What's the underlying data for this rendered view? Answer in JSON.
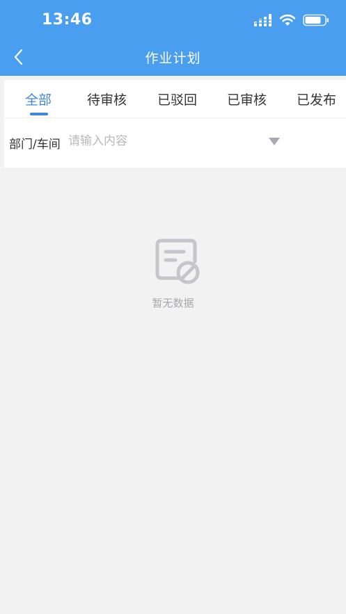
{
  "status_bar": {
    "time": "13:46"
  },
  "nav": {
    "title": "作业计划",
    "back_icon": "chevron-left-icon"
  },
  "tabs": [
    {
      "label": "全部",
      "active": true
    },
    {
      "label": "待审核",
      "active": false
    },
    {
      "label": "已驳回",
      "active": false
    },
    {
      "label": "已审核",
      "active": false
    },
    {
      "label": "已发布",
      "active": false
    }
  ],
  "filter": {
    "label": "部门/车间",
    "placeholder": "请输入内容",
    "value": ""
  },
  "empty_state": {
    "icon": "no-data-document-icon",
    "text": "暂无数据"
  },
  "colors": {
    "header": "#4a9ef0",
    "accent": "#3f86e3",
    "background": "#f2f2f2"
  }
}
